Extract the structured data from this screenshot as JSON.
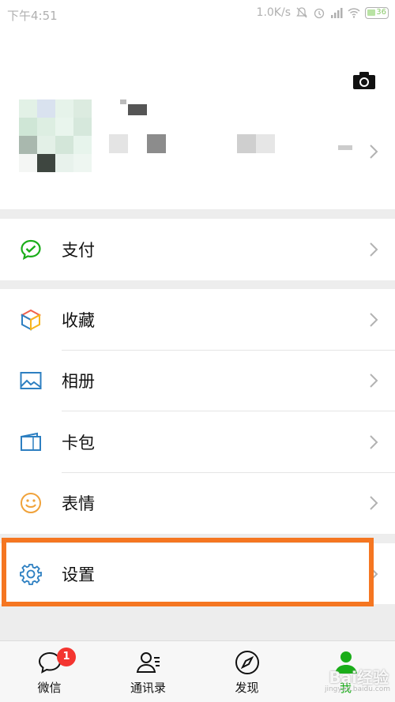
{
  "status_bar": {
    "time": "下午4:51",
    "net_speed": "1.0K/s",
    "battery": "36"
  },
  "profile": {
    "avatar_icon": "blurred-avatar",
    "camera_icon": "camera-icon"
  },
  "menu": {
    "group1": [
      {
        "label": "支付",
        "icon": "wechat-pay-icon",
        "color": "#1aad19"
      }
    ],
    "group2": [
      {
        "label": "收藏",
        "icon": "favorites-cube-icon"
      },
      {
        "label": "相册",
        "icon": "album-icon",
        "color": "#2d7fc1"
      },
      {
        "label": "卡包",
        "icon": "card-wallet-icon",
        "color": "#2d7fc1"
      },
      {
        "label": "表情",
        "icon": "sticker-smile-icon",
        "color": "#f0a23a"
      }
    ],
    "group3": [
      {
        "label": "设置",
        "icon": "settings-gear-icon",
        "color": "#2d7fc1"
      }
    ]
  },
  "tabbar": {
    "tabs": [
      {
        "label": "微信",
        "icon": "chat-bubble-icon",
        "badge": "1"
      },
      {
        "label": "通讯录",
        "icon": "contacts-icon"
      },
      {
        "label": "发现",
        "icon": "compass-icon"
      },
      {
        "label": "我",
        "icon": "me-person-icon",
        "active": true
      }
    ],
    "active_color": "#1aad19"
  },
  "highlight_color": "#f57621",
  "watermark": "Bai经验",
  "watermark_url": "jingyan.baidu.com"
}
